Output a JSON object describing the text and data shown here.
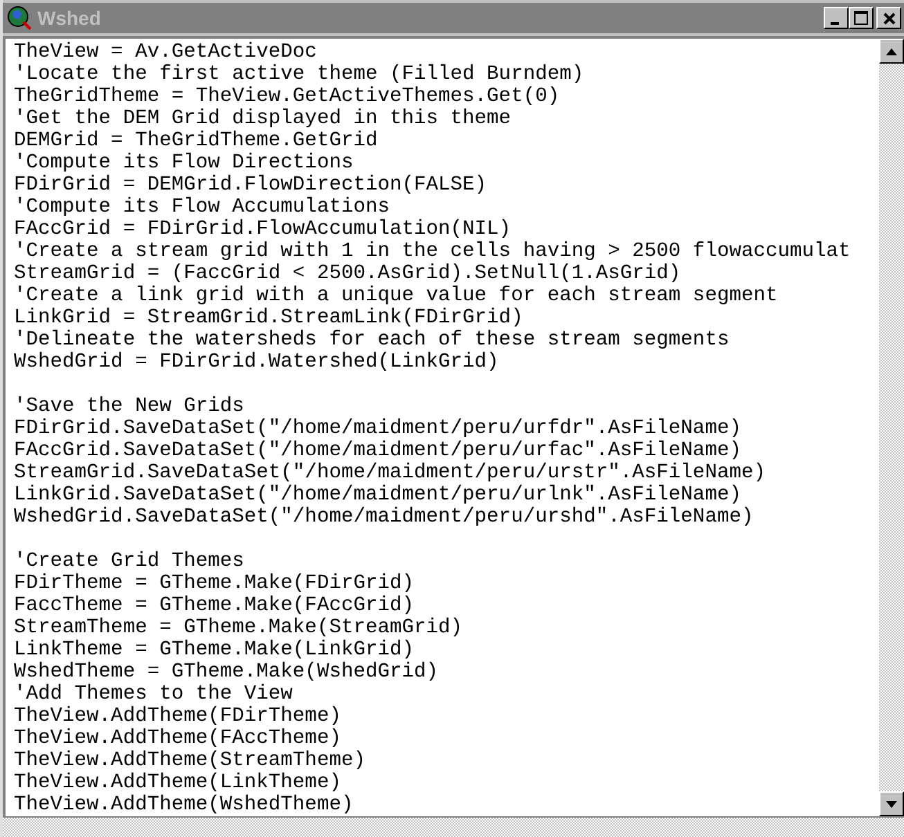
{
  "window": {
    "title": "Wshed"
  },
  "blocks": [
    {
      "lines": [
        "TheView = Av.GetActiveDoc",
        "'Locate the first active theme (Filled Burndem)",
        "TheGridTheme = TheView.GetActiveThemes.Get(0)",
        "'Get the DEM Grid displayed in this theme",
        "DEMGrid = TheGridTheme.GetGrid",
        "'Compute its Flow Directions",
        "FDirGrid = DEMGrid.FlowDirection(FALSE)",
        "'Compute its Flow Accumulations",
        "FAccGrid = FDirGrid.FlowAccumulation(NIL)",
        "'Create a stream grid with 1 in the cells having > 2500 flowaccumulat",
        "StreamGrid = (FaccGrid < 2500.AsGrid).SetNull(1.AsGrid)",
        "'Create a link grid with a unique value for each stream segment",
        "LinkGrid = StreamGrid.StreamLink(FDirGrid)",
        "'Delineate the watersheds for each of these stream segments",
        "WshedGrid = FDirGrid.Watershed(LinkGrid)"
      ]
    },
    {
      "lines": [
        "'Save the New Grids",
        "FDirGrid.SaveDataSet(\"/home/maidment/peru/urfdr\".AsFileName)",
        "FAccGrid.SaveDataSet(\"/home/maidment/peru/urfac\".AsFileName)",
        "StreamGrid.SaveDataSet(\"/home/maidment/peru/urstr\".AsFileName)",
        "LinkGrid.SaveDataSet(\"/home/maidment/peru/urlnk\".AsFileName)",
        "WshedGrid.SaveDataSet(\"/home/maidment/peru/urshd\".AsFileName)"
      ]
    },
    {
      "lines": [
        "'Create Grid Themes",
        "FDirTheme = GTheme.Make(FDirGrid)",
        "FaccTheme = GTheme.Make(FAccGrid)",
        "StreamTheme = GTheme.Make(StreamGrid)",
        "LinkTheme = GTheme.Make(LinkGrid)",
        "WshedTheme = GTheme.Make(WshedGrid)",
        "'Add Themes to the View",
        "TheView.AddTheme(FDirTheme)",
        "TheView.AddTheme(FAccTheme)",
        "TheView.AddTheme(StreamTheme)",
        "TheView.AddTheme(LinkTheme)",
        "TheView.AddTheme(WshedTheme)"
      ]
    }
  ]
}
